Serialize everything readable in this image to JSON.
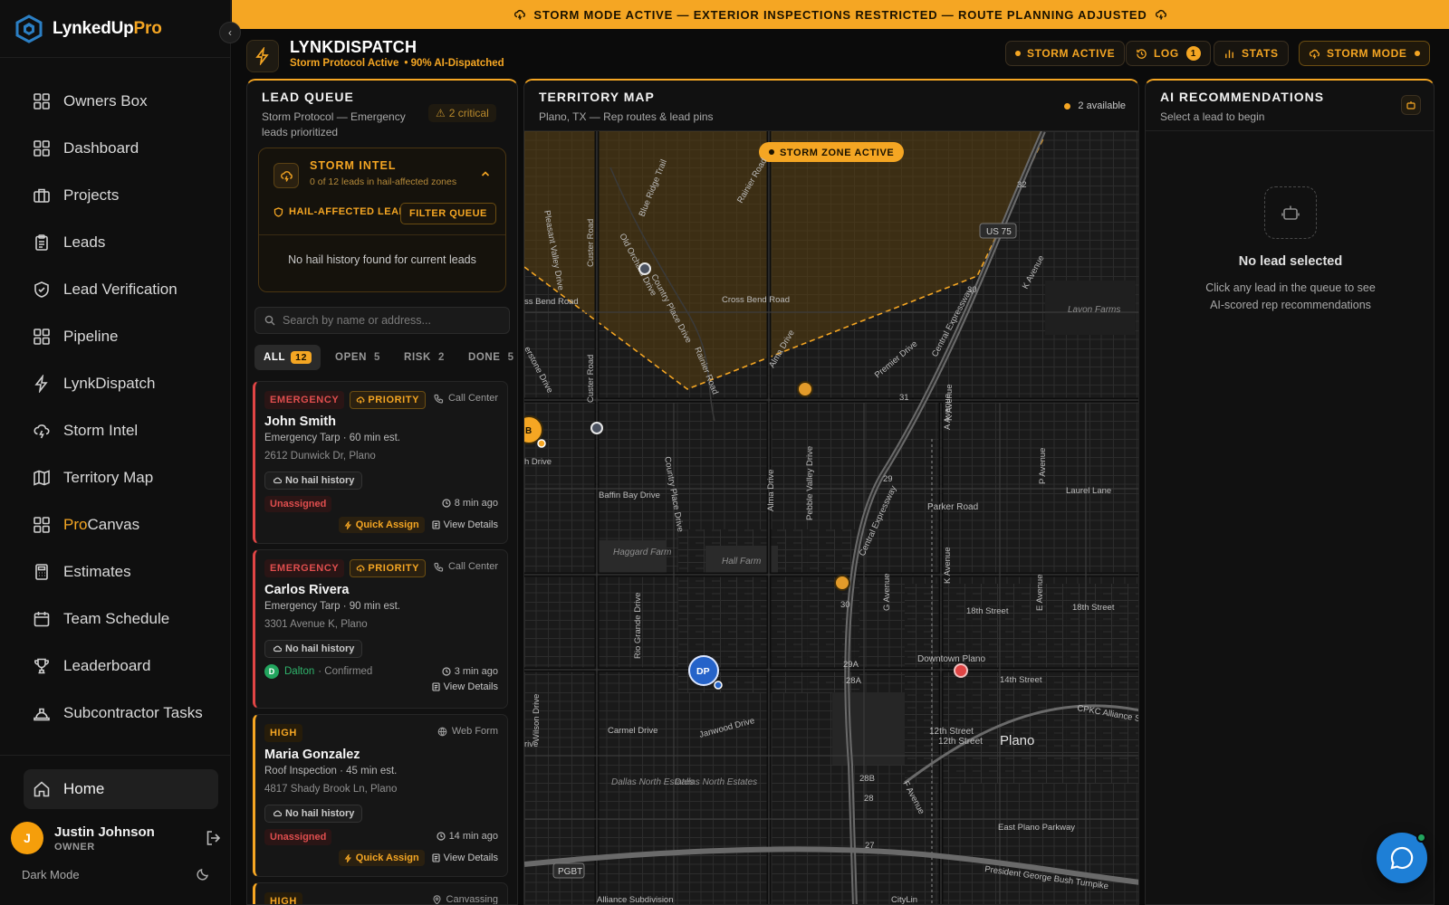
{
  "app": {
    "name_main": "LynkedUp",
    "name_accent": "Pro"
  },
  "sidebar": {
    "items": [
      {
        "label": "Owners Box",
        "icon": "grid-icon"
      },
      {
        "label": "Dashboard",
        "icon": "grid-icon"
      },
      {
        "label": "Projects",
        "icon": "briefcase-icon"
      },
      {
        "label": "Leads",
        "icon": "clipboard-icon"
      },
      {
        "label": "Lead Verification",
        "icon": "shield-check-icon"
      },
      {
        "label": "Pipeline",
        "icon": "grid-icon"
      },
      {
        "label": "LynkDispatch",
        "icon": "bolt-icon"
      },
      {
        "label": "Storm Intel",
        "icon": "cloud-lightning-icon"
      },
      {
        "label": "Territory Map",
        "icon": "map-icon"
      },
      {
        "label": "Canvas",
        "accent": "Pro",
        "icon": "grid-icon"
      },
      {
        "label": "Estimates",
        "icon": "calculator-icon"
      },
      {
        "label": "Team Schedule",
        "icon": "calendar-icon"
      },
      {
        "label": "Leaderboard",
        "icon": "trophy-icon"
      },
      {
        "label": "Subcontractor Tasks",
        "icon": "hardhat-icon"
      }
    ],
    "home": "Home",
    "user": {
      "initial": "J",
      "name": "Justin Johnson",
      "role": "OWNER"
    },
    "dark_mode": "Dark Mode"
  },
  "banner": "STORM MODE ACTIVE — EXTERIOR INSPECTIONS RESTRICTED — ROUTE PLANNING ADJUSTED",
  "header": {
    "title": "LYNKDISPATCH",
    "status": "Storm Protocol Active",
    "dispatch": "• 90% AI-Dispatched",
    "buttons": {
      "storm_active": "STORM ACTIVE",
      "log": "LOG",
      "log_count": "1",
      "stats": "STATS",
      "storm_mode": "STORM MODE"
    }
  },
  "lead_queue": {
    "title": "LEAD QUEUE",
    "subtitle": "Storm Protocol — Emergency leads prioritized",
    "critical": "2 critical",
    "storm_intel": {
      "title": "STORM INTEL",
      "sub": "0 of 12 leads in hail-affected zones",
      "hail_label": "HAIL-AFFECTED LEADS",
      "filter": "FILTER QUEUE",
      "empty": "No hail history found for current leads"
    },
    "search_placeholder": "Search by name or address...",
    "tabs": [
      {
        "label": "ALL",
        "count": "12"
      },
      {
        "label": "OPEN",
        "count": "5"
      },
      {
        "label": "RISK",
        "count": "2"
      },
      {
        "label": "DONE",
        "count": "5"
      }
    ],
    "leads": [
      {
        "urgency": "EMERGENCY",
        "priority": "PRIORITY",
        "source": "Call Center",
        "name": "John Smith",
        "job": "Emergency Tarp · 60 min est.",
        "address": "2612 Dunwick Dr, Plano",
        "history": "No hail history",
        "assign": "Unassigned",
        "time": "8 min ago",
        "quick": "Quick Assign",
        "view": "View Details"
      },
      {
        "urgency": "EMERGENCY",
        "priority": "PRIORITY",
        "source": "Call Center",
        "name": "Carlos Rivera",
        "job": "Emergency Tarp · 90 min est.",
        "address": "3301 Avenue K, Plano",
        "history": "No hail history",
        "rep_initial": "D",
        "rep": "Dalton",
        "rep_status": "· Confirmed",
        "time": "3 min ago",
        "view": "View Details"
      },
      {
        "urgency": "HIGH",
        "source": "Web Form",
        "name": "Maria Gonzalez",
        "job": "Roof Inspection · 45 min est.",
        "address": "4817 Shady Brook Ln, Plano",
        "history": "No hail history",
        "assign": "Unassigned",
        "time": "14 min ago",
        "quick": "Quick Assign",
        "view": "View Details"
      },
      {
        "urgency": "HIGH",
        "source": "Canvassing"
      }
    ]
  },
  "map": {
    "title": "TERRITORY MAP",
    "subtitle": "Plano, TX — Rep routes & lead pins",
    "available": "2 available",
    "storm_zone": "STORM ZONE ACTIVE",
    "labels": {
      "blue_ridge": "Blue Ridge Trail",
      "rainier_n": "Rainier Road",
      "pleasant_valley": "Pleasant Valley Drive",
      "custer_n": "Custer Road",
      "old_orchard": "Old Orchard Drive",
      "country_place_n": "Country Place Drive",
      "cross_bend": "Cross Bend Road",
      "bend_w": "ss Bend Road",
      "rainier_s": "Rainier Road",
      "alma_n": "Alma Drive",
      "premier": "Premier Drive",
      "central": "Central Expressway",
      "k_ave_ne": "K Avenue",
      "us75": "US 75",
      "lavon": "Lavon Farms",
      "laurel": "Laurel Lane",
      "baffin": "Baffin Bay Drive",
      "country_place_s": "Country Place Drive",
      "alma_s": "Alma Drive",
      "pebble": "Pebble Valley Drive",
      "central_s": "Central Expressway",
      "parker": "Parker Road",
      "k_ave": "K Avenue",
      "g_ave": "G Avenue",
      "eighteenth": "18th Street",
      "eighteenth_e": "18th Street",
      "fourteenth": "14th Street",
      "twelfth": "12th Street",
      "twelfth_b": "12th Street",
      "downtown": "Downtown Plano",
      "plano": "Plano",
      "cpkc": "CPKC Alliance Su",
      "carmel": "Carmel Drive",
      "janwood": "Janwood Drive",
      "dallas_ne": "Dallas North Estates",
      "dallas_ne2": "Dallas North Estates",
      "rio": "Rio Grande Drive",
      "wilson": "Wilson Drive",
      "custer_s": "Custer Road",
      "haggard": "Haggard Farm",
      "hall": "Hall Farm",
      "east_plano": "East Plano Parkway",
      "pgbt": "PGBT",
      "pres_bush": "President George Bush Turnpike",
      "alliance": "Alliance Subdivision",
      "citylin": "CityLin",
      "f_ave": "F Avenue",
      "e_ave": "E Avenue",
      "a_ave": "A Avenue",
      "p_ave": "P Avenue",
      "k_ave2": "K Avenue",
      "stone": "erstone Drive",
      "n_drive": "h Drive",
      "drive_sw": "rive",
      "n32": "32",
      "n30": "30",
      "n31": "31",
      "n29": "29",
      "n30b": "30",
      "n29a": "29A",
      "n28a": "28A",
      "n28b": "28B",
      "n28": "28",
      "n27": "27",
      "pin_dp": "DP",
      "pin_b": "B"
    }
  },
  "ai": {
    "title": "AI RECOMMENDATIONS",
    "subtitle": "Select a lead to begin",
    "empty_title": "No lead selected",
    "empty_text": "Click any lead in the queue to see AI-scored rep recommendations"
  },
  "colors": {
    "accent": "#f5a623",
    "emergency": "#e04545",
    "success": "#22a55e",
    "chat": "#1e7fd6"
  }
}
